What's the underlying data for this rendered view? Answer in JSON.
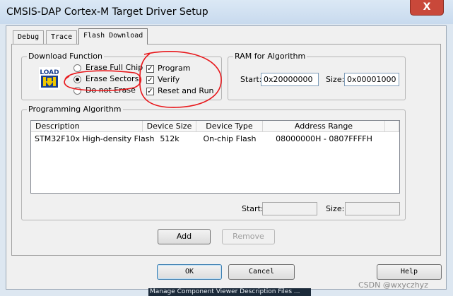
{
  "window": {
    "title": "CMSIS-DAP Cortex-M Target Driver Setup",
    "close_label": "X"
  },
  "tabs": [
    {
      "label": "Debug"
    },
    {
      "label": "Trace"
    },
    {
      "label": "Flash Download"
    }
  ],
  "download_function": {
    "legend": "Download Function",
    "icon_label": "LOAD",
    "erase_full_chip": "Erase Full Chip",
    "erase_sectors": "Erase Sectors",
    "do_not_erase": "Do not Erase",
    "program": "Program",
    "verify": "Verify",
    "reset_and_run": "Reset and Run",
    "selected_erase": "Erase Sectors",
    "program_checked": true,
    "verify_checked": true,
    "reset_checked": true
  },
  "ram": {
    "legend": "RAM for Algorithm",
    "start_label": "Start:",
    "start_value": "0x20000000",
    "size_label": "Size:",
    "size_value": "0x00001000"
  },
  "programming": {
    "legend": "Programming Algorithm",
    "columns": [
      "Description",
      "Device Size",
      "Device Type",
      "Address Range"
    ],
    "rows": [
      [
        "STM32F10x High-density Flash",
        "512k",
        "On-chip Flash",
        "08000000H - 0807FFFFH"
      ]
    ],
    "start_label": "Start:",
    "start_value": "",
    "size_label": "Size:",
    "size_value": "",
    "add_label": "Add",
    "remove_label": "Remove"
  },
  "footer": {
    "ok_label": "OK",
    "cancel_label": "Cancel",
    "help_label": "Help"
  },
  "taskbar_text": "Manage Component Viewer Description Files ...",
  "watermark": "CSDN @wxyczhyz",
  "colors": {
    "annotation": "#e8171b",
    "focus_border": "#3c7fb1"
  }
}
